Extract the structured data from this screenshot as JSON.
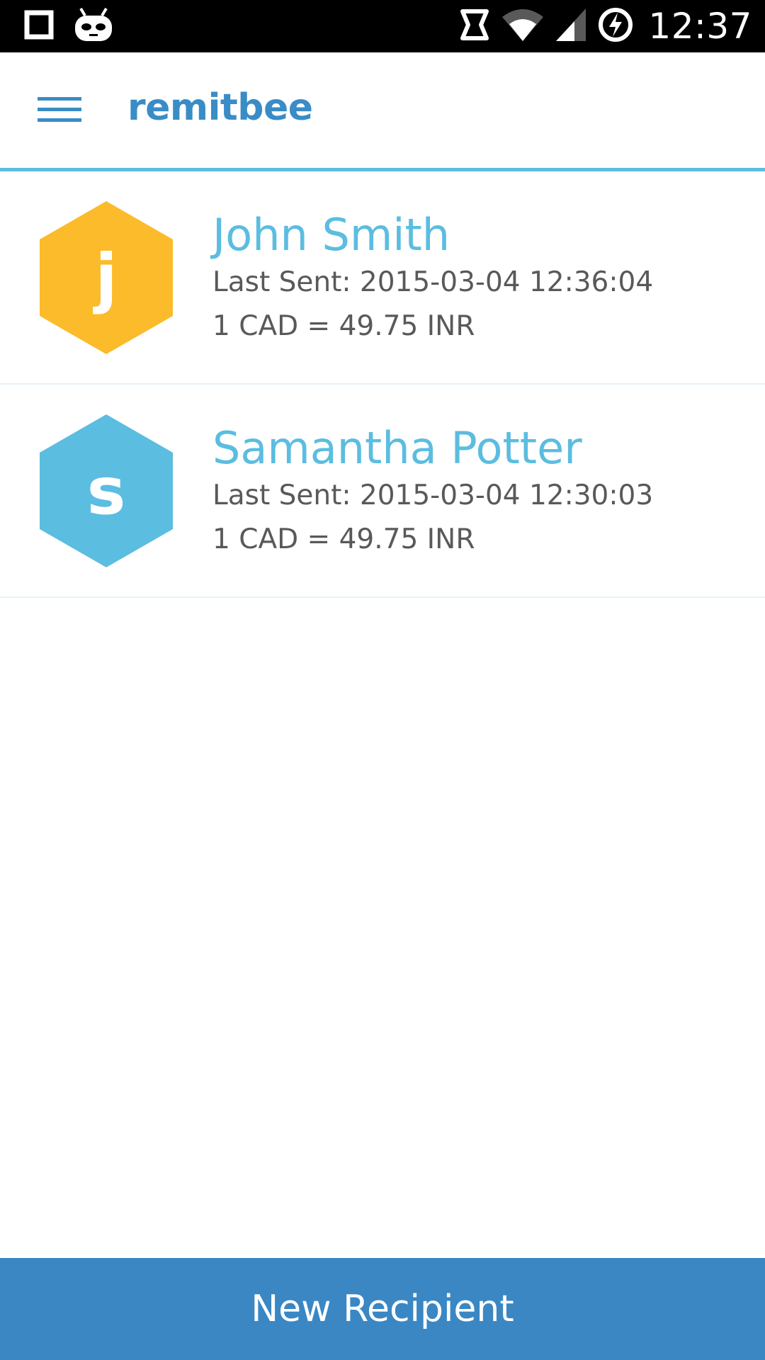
{
  "status_bar": {
    "time": "12:37",
    "icons": [
      "square-notification-icon",
      "cyanogenmod-bot-icon",
      "sync-icon",
      "wifi-icon",
      "cell-signal-icon",
      "battery-charging-icon"
    ]
  },
  "app_bar": {
    "title": "remitbee",
    "menu_icon": "hamburger-menu-icon"
  },
  "recipients": [
    {
      "initial": "j",
      "avatar_color": "#fbbb2a",
      "name": "John Smith",
      "last_sent": "Last Sent: 2015-03-04 12:36:04",
      "rate": "1 CAD = 49.75 INR"
    },
    {
      "initial": "s",
      "avatar_color": "#5bbde0",
      "name": "Samantha Potter",
      "last_sent": "Last Sent: 2015-03-04 12:30:03",
      "rate": "1 CAD = 49.75 INR"
    }
  ],
  "footer": {
    "new_recipient_label": "New Recipient"
  },
  "colors": {
    "brand": "#3a8cc6",
    "accent": "#5bbde0",
    "button": "#3a87c4"
  }
}
